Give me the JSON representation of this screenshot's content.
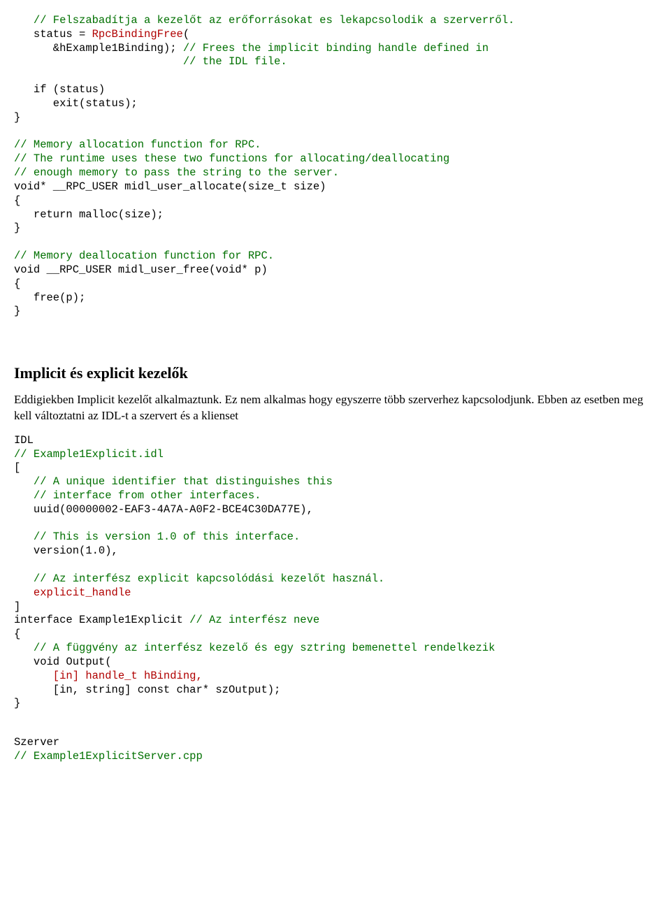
{
  "code1": {
    "l01": "   // Felszabadítja a kezelőt az erőforrásokat es lekapcsolodik a szerverről.",
    "l02a": "   status = ",
    "l02b": "RpcBindingFree",
    "l02c": "(",
    "l03a": "      &hExample1Binding); ",
    "l03b": "// Frees the implicit binding handle defined in",
    "l04": "                          // the IDL file.",
    "l05": "",
    "l06": "   if (status)",
    "l07": "      exit(status);",
    "l08": "}",
    "l09": "",
    "l10": "// Memory allocation function for RPC.",
    "l11": "// The runtime uses these two functions for allocating/deallocating",
    "l12": "// enough memory to pass the string to the server.",
    "l13": "void* __RPC_USER midl_user_allocate(size_t size)",
    "l14": "{",
    "l15": "   return malloc(size);",
    "l16": "}",
    "l17": "",
    "l18": "// Memory deallocation function for RPC.",
    "l19": "void __RPC_USER midl_user_free(void* p)",
    "l20": "{",
    "l21": "   free(p);",
    "l22": "}"
  },
  "heading": "Implicit és explicit kezelők",
  "paragraph": "Eddigiekben Implicit kezelőt alkalmaztunk. Ez nem alkalmas  hogy egyszerre több szerverhez kapcsolodjunk. Ebben az esetben meg kell változtatni az IDL-t a szervert és a klienset",
  "idl": {
    "l00": "IDL",
    "l01": "// Example1Explicit.idl",
    "l02": "[",
    "l03": "   // A unique identifier that distinguishes this",
    "l04": "   // interface from other interfaces.",
    "l05": "   uuid(00000002-EAF3-4A7A-A0F2-BCE4C30DA77E),",
    "l06": "",
    "l07": "   // This is version 1.0 of this interface.",
    "l08": "   version(1.0),",
    "l09": "",
    "l10": "   // Az interfész explicit kapcsolódási kezelőt használ.",
    "l11": "   explicit_handle",
    "l12": "]",
    "l13a": "interface Example1Explicit ",
    "l13b": "// Az interfész neve",
    "l14": "{",
    "l15": "   // A függvény az interfész kezelő és egy sztring bemenettel rendelkezik",
    "l16": "   void Output(",
    "l17": "      [in] handle_t hBinding,",
    "l18": "      [in, string] const char* szOutput);",
    "l19": "}"
  },
  "server": {
    "l00": "Szerver",
    "l01": "// Example1ExplicitServer.cpp"
  }
}
